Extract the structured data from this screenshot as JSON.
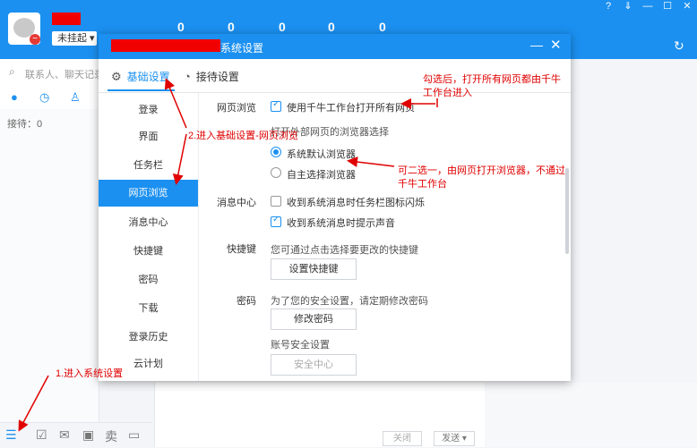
{
  "app": {
    "status_label": "未挂起 ▾",
    "counts": [
      "0",
      "0",
      "0",
      "0",
      "0"
    ],
    "window_controls": [
      "?",
      "⇓",
      "—",
      "☐",
      "✕"
    ],
    "search_placeholder": "联系人、聊天记录",
    "waiting_label": "接待：0",
    "chat_buttons": {
      "close": "关闭",
      "send": "发送 ▾"
    }
  },
  "dialog": {
    "title": "系统设置",
    "tabs": [
      {
        "label": "基础设置",
        "icon": "gear-icon",
        "active": true
      },
      {
        "label": "接待设置",
        "icon": "clock-icon",
        "active": false
      }
    ],
    "nav_items": [
      "登录",
      "界面",
      "任务栏",
      "网页浏览",
      "消息中心",
      "快捷键",
      "密码",
      "下载",
      "登录历史",
      "云计划"
    ],
    "active_nav": "网页浏览",
    "web": {
      "section_label": "网页浏览",
      "open_all_in_qianniu": "使用千牛工作台打开所有网页",
      "external_label": "打开外部网页的浏览器选择",
      "radio_default": "系统默认浏览器",
      "radio_custom": "自主选择浏览器"
    },
    "message": {
      "section_label": "消息中心",
      "flash_taskbar": "收到系统消息时任务栏图标闪烁",
      "play_sound": "收到系统消息时提示声音"
    },
    "shortcut": {
      "section_label": "快捷键",
      "desc": "您可通过点击选择要更改的快捷键",
      "button": "设置快捷键"
    },
    "password": {
      "section_label": "密码",
      "desc": "为了您的安全设置，请定期修改密码",
      "button": "修改密码",
      "account_label": "账号安全设置",
      "security_button": "安全中心"
    }
  },
  "annotations": {
    "a1": "勾选后，打开所有网页都由千牛",
    "a1b": "工作台进入",
    "a2": "2.进入基础设置-网页浏览",
    "a3": "可二选一，由网页打开浏览器，不通过",
    "a3b": "千牛工作台",
    "a4": "1.进入系统设置"
  },
  "colors": {
    "accent": "#1b90f0",
    "annotation": "#e00000",
    "redaction": "#f00000"
  }
}
